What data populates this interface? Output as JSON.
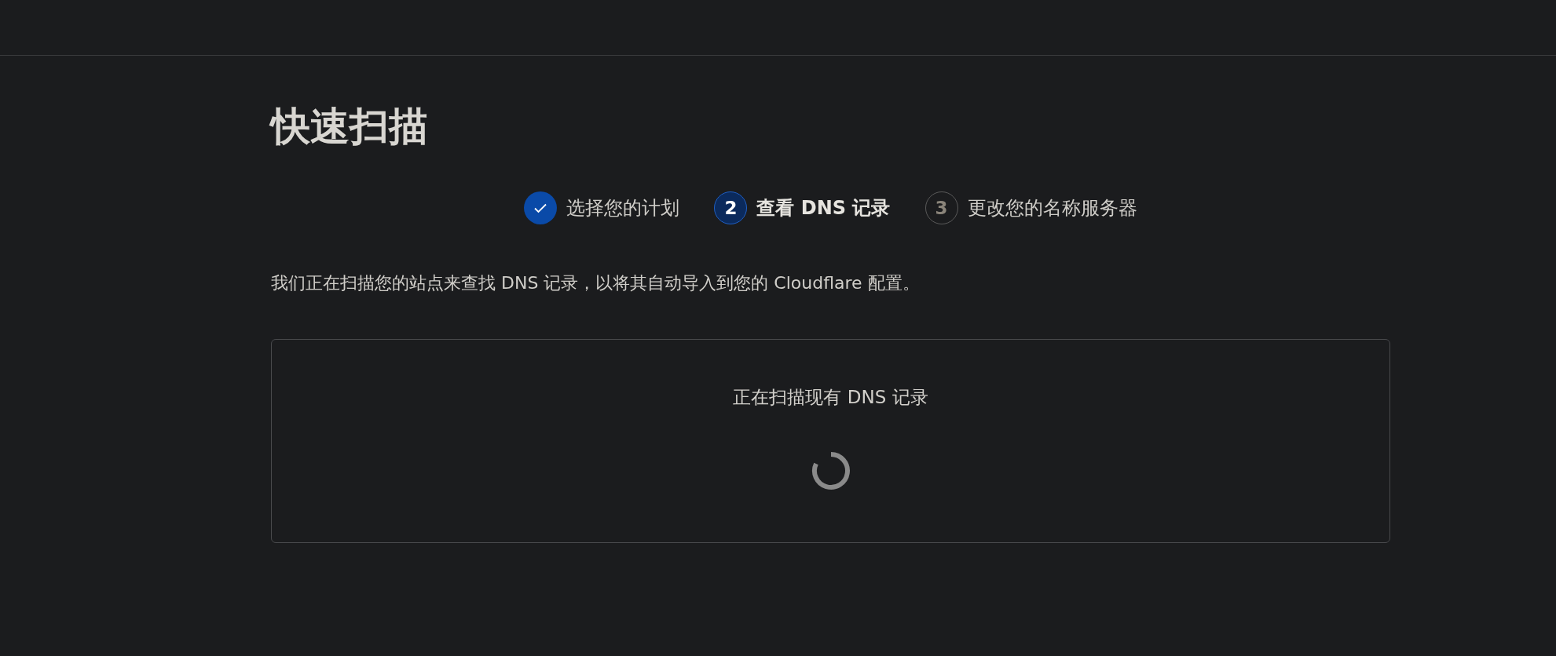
{
  "page": {
    "title": "快速扫描"
  },
  "steps": [
    {
      "label": "选择您的计划",
      "kind": "complete"
    },
    {
      "number": "2",
      "label": "查看 DNS 记录",
      "kind": "current"
    },
    {
      "number": "3",
      "label": "更改您的名称服务器",
      "kind": "upcoming"
    }
  ],
  "description": "我们正在扫描您的站点来查找 DNS 记录，以将其自动导入到您的 Cloudflare 配置。",
  "scan_card": {
    "message": "正在扫描现有 DNS 记录",
    "loading": true
  }
}
